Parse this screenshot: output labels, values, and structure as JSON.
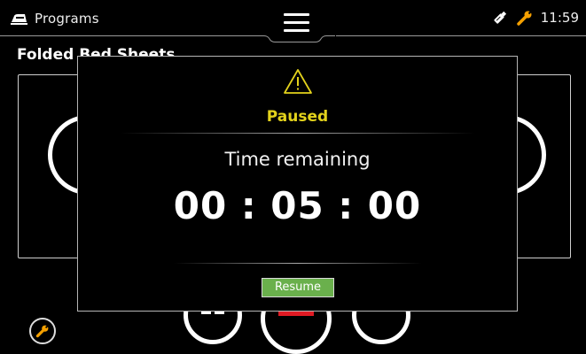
{
  "statusbar": {
    "app_title": "Programs",
    "time": "11:59",
    "icons": [
      "iron-icon",
      "menu-icon",
      "usb-icon",
      "wrench-icon"
    ],
    "accent_color": "#f5a000"
  },
  "page": {
    "title": "Folded Bed Sheets"
  },
  "modal": {
    "status": "Paused",
    "status_color": "#e3d21c",
    "time_label": "Time remaining",
    "countdown": "00 : 05 : 00",
    "resume_label": "Resume",
    "resume_color": "#6ab04c"
  },
  "bottom_controls": {
    "icons": [
      "pause-icon",
      "stop-icon",
      "minus-icon",
      "wrench-icon"
    ]
  }
}
